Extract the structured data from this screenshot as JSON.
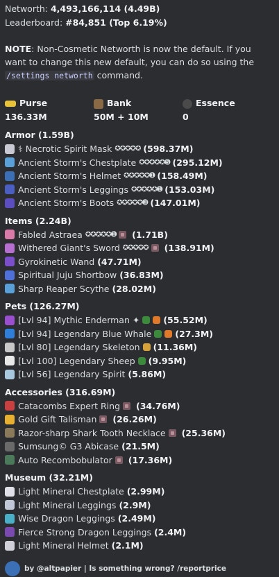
{
  "header": {
    "networth_label": "Networth: ",
    "networth_value": "4,493,166,114 (4.49B)",
    "leaderboard_label": "Leaderboard: ",
    "leaderboard_value": "#84,851 (Top 6.19%)"
  },
  "note": {
    "label": "NOTE",
    "text1": ": Non-Cosmetic Networth is now the default. If you want to change this new default, you can do so using the ",
    "command": "/settings networth",
    "text2": " command."
  },
  "stats": [
    {
      "label": "Purse",
      "value": "136.33M",
      "icon": "gold-ingot-icon",
      "color": "#e8c33a"
    },
    {
      "label": "Bank",
      "value": "50M + 10M",
      "icon": "chest-icon",
      "color": "#8a6a45"
    },
    {
      "label": "Essence",
      "value": "0",
      "icon": "wither-essence-icon",
      "color": "#4a4a4a"
    }
  ],
  "armor": {
    "title": "Armor (1.59B)",
    "items": [
      {
        "prefix": "⚕ ",
        "name": "Necrotic Spirit Mask",
        "stars": "✪✪✪✪✪",
        "value": "(598.37M)",
        "icon_color": "#c9c9d3"
      },
      {
        "name": "Ancient Storm's Chestplate",
        "stars": "✪✪✪✪✪➎",
        "value": "(295.12M)",
        "icon_color": "#5aa0d8"
      },
      {
        "name": "Ancient Storm's Helmet",
        "stars": "✪✪✪✪✪➊",
        "value": "(158.49M)",
        "icon_color": "#3b6fb6"
      },
      {
        "name": "Ancient Storm's Leggings",
        "stars": "✪✪✪✪✪➊",
        "value": "(153.03M)",
        "icon_color": "#4a5fc1"
      },
      {
        "name": "Ancient Storm's Boots",
        "stars": "✪✪✪✪✪➌",
        "value": "(147.01M)",
        "icon_color": "#5c4ec0"
      }
    ]
  },
  "items": {
    "title": "Items (2.24B)",
    "items": [
      {
        "name": "Fabled Astraea",
        "stars": "✪✪✪✪✪➊",
        "value": "(1.71B)",
        "gem": true,
        "icon_color": "#d97aa8"
      },
      {
        "name": "Withered Giant's Sword",
        "stars": "✪✪✪✪✪",
        "value": "(138.91M)",
        "gem": true,
        "icon_color": "#b66fd0"
      },
      {
        "name": "Gyrokinetic Wand",
        "value": "(47.71M)",
        "icon_color": "#7a4fc9"
      },
      {
        "name": "Spiritual Juju Shortbow",
        "value": "(36.83M)",
        "icon_color": "#4f6fd9"
      },
      {
        "name": "Sharp Reaper Scythe",
        "value": "(28.02M)",
        "icon_color": "#5aa0d8"
      }
    ]
  },
  "pets": {
    "title": "Pets (126.27M)",
    "items": [
      {
        "name": "[Lvl 94] Mythic Enderman ✦",
        "value": "(55.52M)",
        "icon_color": "#9a4fd0",
        "extras": [
          "#3c8a3c",
          "#e07a2a"
        ]
      },
      {
        "name": "[Lvl 94] Legendary Blue Whale",
        "value": "(27.3M)",
        "icon_color": "#2f7fd8",
        "extras": [
          "#3c8a3c",
          "#e07a2a"
        ]
      },
      {
        "name": "[Lvl 80] Legendary Skeleton",
        "value": "(11.36M)",
        "icon_color": "#c8c8c8",
        "extras": [
          "#d8a23a"
        ]
      },
      {
        "name": "[Lvl 100] Legendary Sheep",
        "value": "(9.95M)",
        "icon_color": "#e8e8e8",
        "extras": [
          "#3c8a3c"
        ]
      },
      {
        "name": "[Lvl 56] Legendary Spirit",
        "value": "(5.86M)",
        "icon_color": "#a8c8e0"
      }
    ]
  },
  "accessories": {
    "title": "Accessories (316.69M)",
    "items": [
      {
        "name": "Catacombs Expert Ring",
        "value": "(34.76M)",
        "gem": true,
        "icon_color": "#c84040"
      },
      {
        "name": "Gold Gift Talisman",
        "value": "(26.26M)",
        "gem": true,
        "icon_color": "#e8b030"
      },
      {
        "name": "Razor-sharp Shark Tooth Necklace",
        "value": "(25.36M)",
        "gem": true,
        "icon_color": "#8a7a5a"
      },
      {
        "name": "Sumsung© G3 Abicase",
        "value": "(21.5M)",
        "icon_color": "#6a6a6a"
      },
      {
        "name": "Auto Recombobulator",
        "value": "(17.36M)",
        "gem": true,
        "icon_color": "#4a7a5a"
      }
    ]
  },
  "museum": {
    "title": "Museum (32.21M)",
    "items": [
      {
        "name": "Light Mineral Chestplate",
        "value": "(2.99M)",
        "icon_color": "#e0e0e8"
      },
      {
        "name": "Light Mineral Leggings",
        "value": "(2.9M)",
        "icon_color": "#c0c8d8"
      },
      {
        "name": "Wise Dragon Leggings",
        "value": "(2.49M)",
        "icon_color": "#4ab0c8"
      },
      {
        "name": "Fierce Strong Dragon Leggings",
        "value": "(2.4M)",
        "icon_color": "#7a4ab0"
      },
      {
        "name": "Light Mineral Helmet",
        "value": "(2.1M)",
        "icon_color": "#d0d0d8"
      }
    ]
  },
  "footer": {
    "text": "by @altpapier | Is something wrong? /reportprice"
  }
}
